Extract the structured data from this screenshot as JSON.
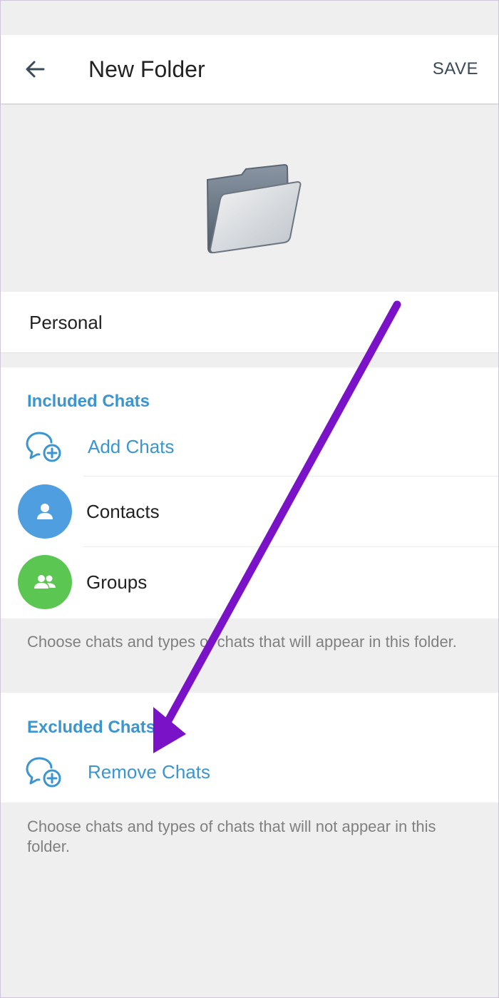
{
  "header": {
    "title": "New Folder",
    "save_label": "SAVE"
  },
  "folder_name": {
    "value": "Personal"
  },
  "included": {
    "header": "Included Chats",
    "add_label": "Add Chats",
    "items": [
      {
        "label": "Contacts",
        "color": "#4f9fe0",
        "icon": "person-icon"
      },
      {
        "label": "Groups",
        "color": "#5cc653",
        "icon": "people-icon"
      }
    ],
    "hint": "Choose chats and types of chats that will appear in this folder."
  },
  "excluded": {
    "header": "Excluded Chats",
    "remove_label": "Remove Chats",
    "hint": "Choose chats and types of chats that will not appear in this folder."
  },
  "colors": {
    "accent": "#3a95d0",
    "annotation_arrow": "#7a12c8"
  }
}
